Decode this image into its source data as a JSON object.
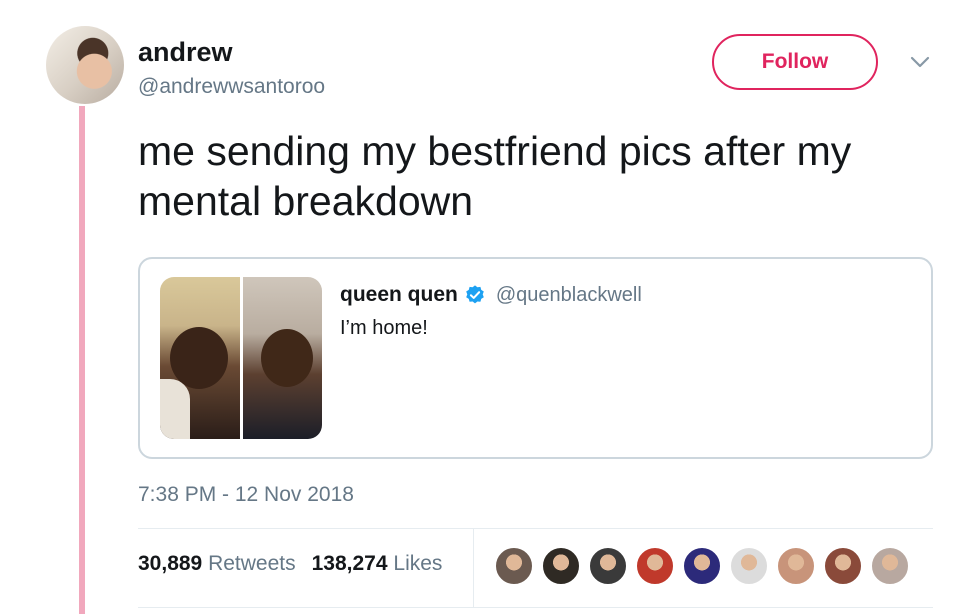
{
  "tweet": {
    "author_name": "andrew",
    "author_handle": "@andrewwsantoroo",
    "follow_label": "Follow",
    "text": "me sending my bestfriend pics after my mental breakdown",
    "timestamp": "7:38 PM - 12 Nov 2018"
  },
  "quote": {
    "name": "queen quen",
    "handle": "@quenblackwell",
    "text": "I’m home!"
  },
  "stats": {
    "retweets_count": "30,889",
    "retweets_label": "Retweets",
    "likes_count": "138,274",
    "likes_label": "Likes"
  },
  "icons": {
    "moon": "crescent-moon-emoji",
    "verified": "verified-badge",
    "chevron": "chevron-down"
  },
  "colors": {
    "follow_accent": "#e0245e",
    "thread_line": "#f1a8bd",
    "secondary_text": "#657786",
    "verified_blue": "#1da1f2"
  },
  "likers": [
    {
      "color": "#6b5a50"
    },
    {
      "color": "#2f2a24"
    },
    {
      "color": "#3a3a3a"
    },
    {
      "color": "#c0392b"
    },
    {
      "color": "#2c2a7a"
    },
    {
      "color": "#dcdcdc"
    },
    {
      "color": "#c8947a"
    },
    {
      "color": "#8a4a3a"
    },
    {
      "color": "#b8a8a0"
    }
  ]
}
